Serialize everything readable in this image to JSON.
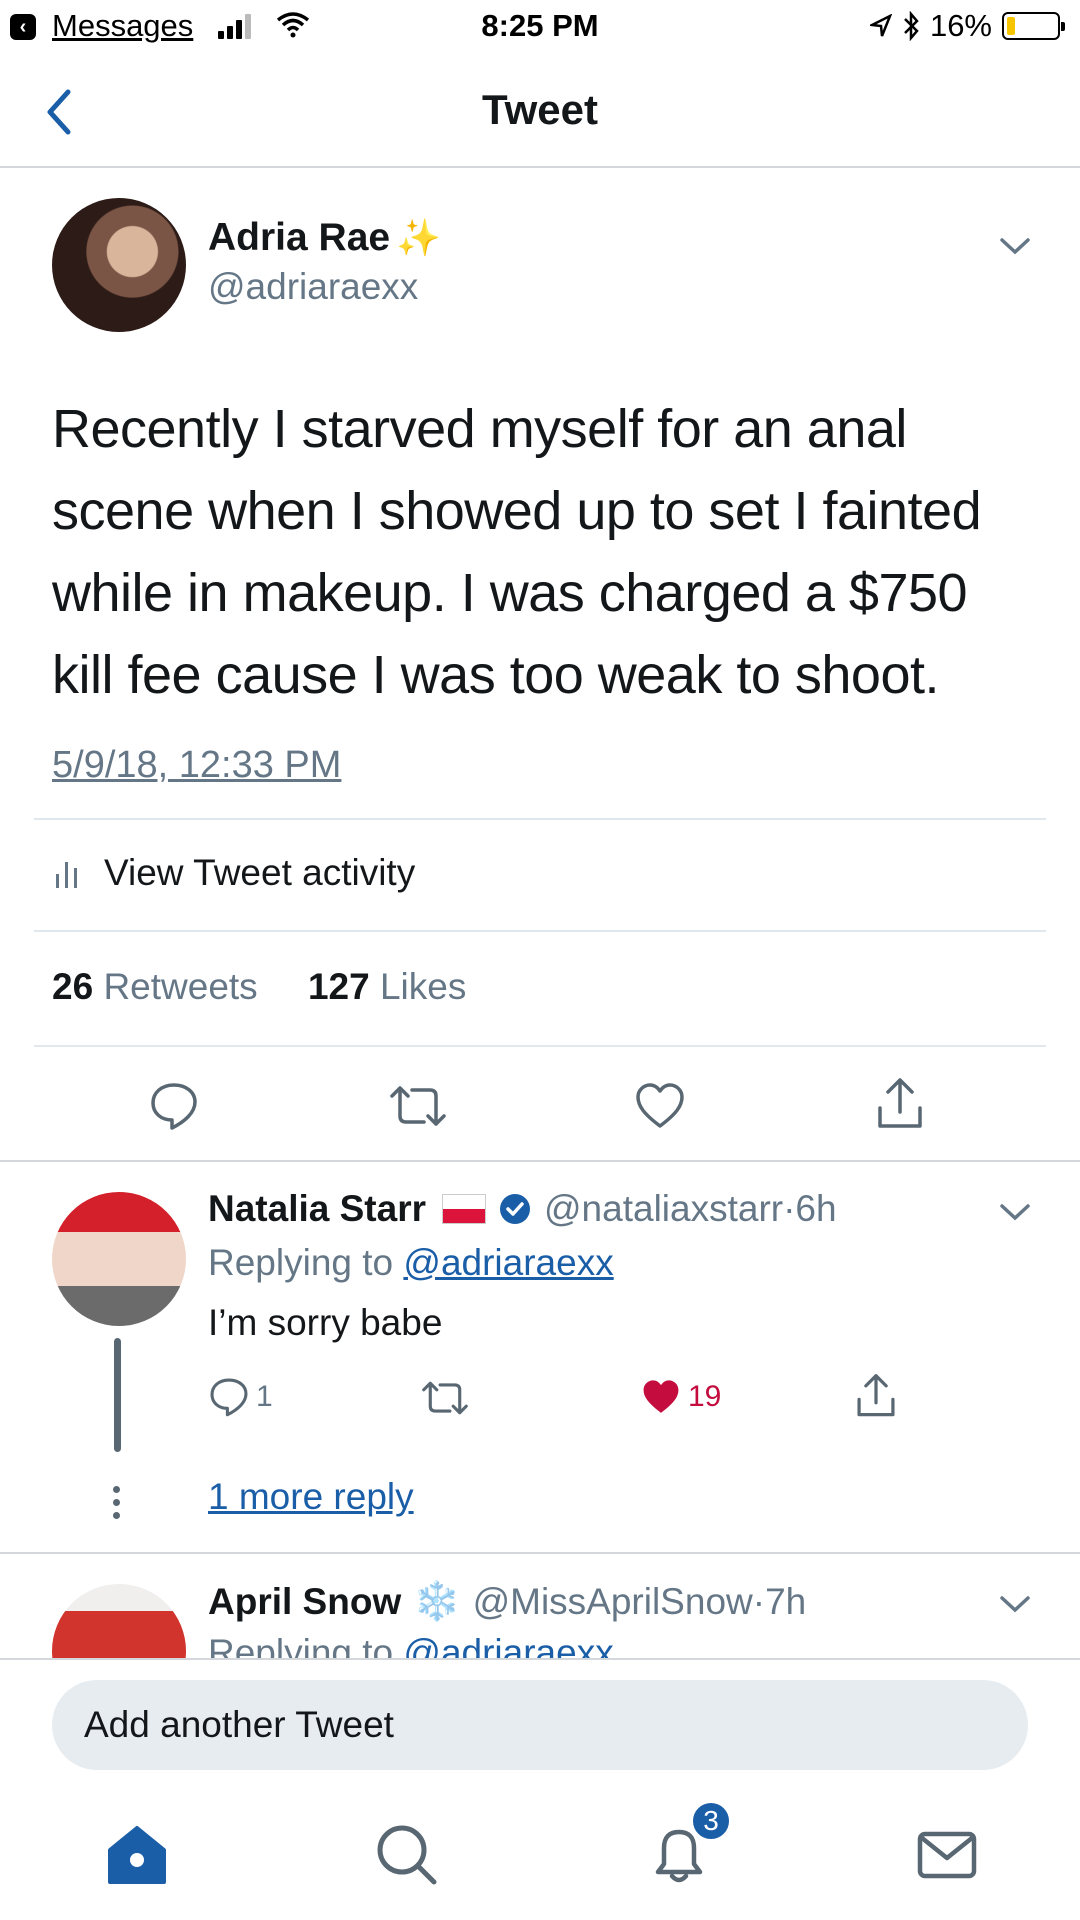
{
  "status_bar": {
    "back_app": "Messages",
    "time": "8:25 PM",
    "battery": "16%",
    "battery_level": 0.16,
    "icons": [
      "cellular-signal-icon",
      "wifi-icon",
      "location-arrow-icon",
      "bluetooth-icon",
      "battery-icon"
    ]
  },
  "nav": {
    "title": "Tweet",
    "back_icon": "chevron-left-icon"
  },
  "tweet": {
    "name": "Adria Rae",
    "name_emoji": "✨",
    "handle": "@adriaraexx",
    "text": "Recently I starved myself for an anal scene when I showed up to set I fainted while in makeup. I was charged a $750 kill fee cause I was too weak to shoot.",
    "timestamp": "5/9/18, 12:33 PM",
    "activity_label": "View Tweet activity",
    "retweets_count": "26",
    "retweets_label": "Retweets",
    "likes_count": "127",
    "likes_label": "Likes",
    "actions": [
      "reply-icon",
      "retweet-icon",
      "like-icon",
      "share-icon"
    ]
  },
  "replies": [
    {
      "name": "Natalia Starr",
      "handle": "@nataliaxstarr",
      "time_sep": " · ",
      "time": "6h",
      "replying_prefix": "Replying to ",
      "replying_to": "@adriaraexx",
      "text": "I’m sorry babe",
      "reply_count": "1",
      "like_count": "19",
      "liked": true,
      "more_replies": "1 more reply"
    },
    {
      "name": "April Snow",
      "name_emoji": "❄️",
      "handle": "@MissAprilSnow",
      "time_sep": " · ",
      "time": "7h",
      "replying_prefix": "Replying to ",
      "replying_to": "@adriaraexx"
    }
  ],
  "compose": {
    "placeholder": "Add another Tweet"
  },
  "tabbar": {
    "tabs": [
      "home-icon",
      "search-icon",
      "notifications-icon",
      "messages-icon"
    ],
    "notifications_badge": "3"
  },
  "colors": {
    "accent": "#1b5ea8",
    "like": "#c40c3e",
    "secondary_text": "#657786",
    "divider": "#e1e8ed"
  }
}
